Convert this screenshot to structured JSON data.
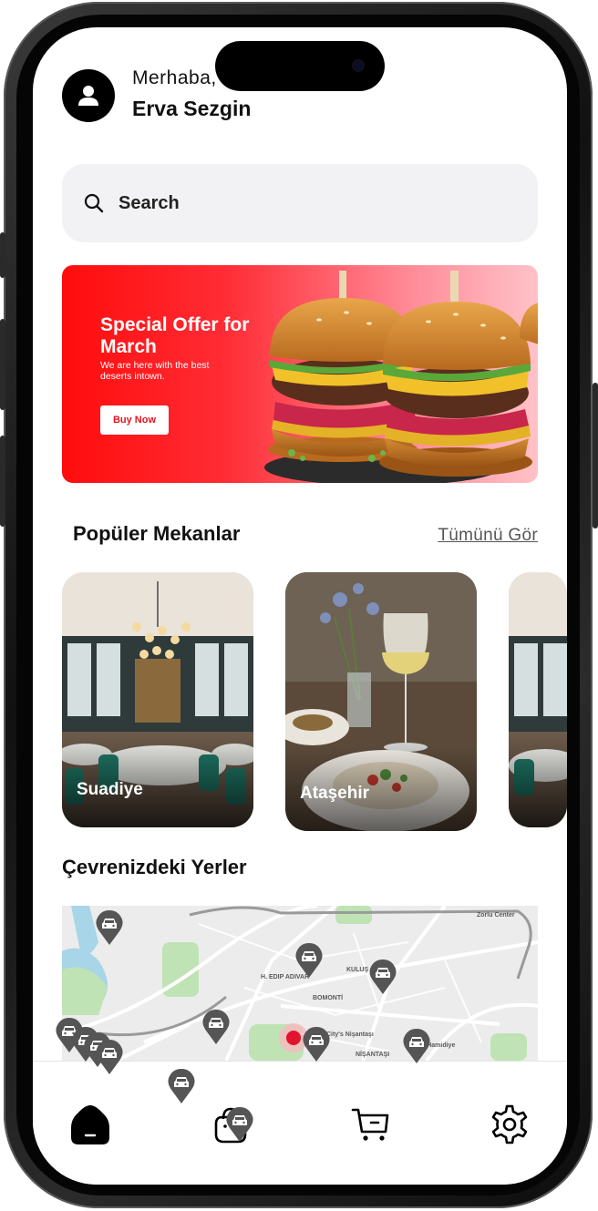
{
  "header": {
    "greeting": "Merhaba,",
    "username": "Erva Sezgin"
  },
  "search": {
    "placeholder": "Search"
  },
  "banner": {
    "title": "Special Offer for March",
    "subtitle": "We are here with the best deserts intown.",
    "button_label": "Buy Now"
  },
  "popular": {
    "title": "Popüler Mekanlar",
    "see_all": "Tümünü Gör",
    "cards": [
      {
        "label": "Suadiye"
      },
      {
        "label": "Ataşehir"
      },
      {
        "label": ""
      }
    ]
  },
  "nearby": {
    "title": "Çevrenizdeki Yerler",
    "map_labels": [
      "Zorlu Center",
      "H. EDIP ADIVAR",
      "BOMONTİ",
      "KULUŞ",
      "City's Nişantaşı",
      "NİŞANTAŞI",
      "Yıldız Hamidiye"
    ]
  },
  "nav": {
    "items": [
      {
        "name": "home",
        "icon": "home-icon",
        "active": true
      },
      {
        "name": "basket",
        "icon": "shopping-bag-icon",
        "active": false
      },
      {
        "name": "cart",
        "icon": "cart-icon",
        "active": false
      },
      {
        "name": "settings",
        "icon": "gear-icon",
        "active": false
      }
    ]
  },
  "colors": {
    "accent": "#ff0c0c",
    "text": "#111111",
    "search_bg": "#f2f2f5"
  }
}
